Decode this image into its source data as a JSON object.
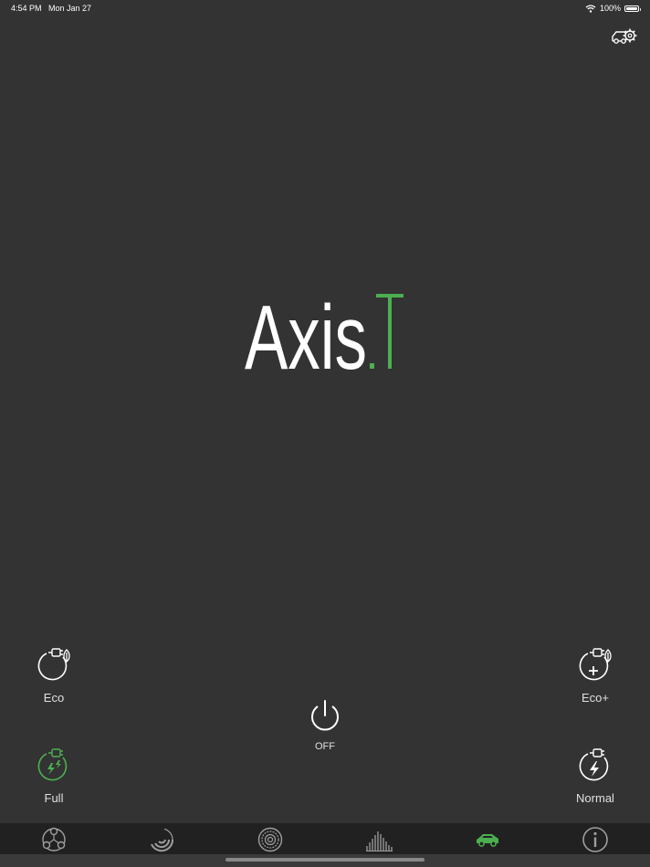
{
  "status_bar": {
    "time": "4:54 PM",
    "date": "Mon Jan 27",
    "battery": "100%"
  },
  "logo": {
    "text_main": "Axis",
    "text_dot": ".",
    "text_accent": "T"
  },
  "modes": {
    "eco": {
      "label": "Eco",
      "active": false
    },
    "eco_plus": {
      "label": "Eco+",
      "active": false
    },
    "full": {
      "label": "Full",
      "active": true
    },
    "normal": {
      "label": "Normal",
      "active": false
    }
  },
  "power": {
    "label": "OFF"
  },
  "tabs": [
    {
      "icon": "triad-circles-icon",
      "active": false
    },
    {
      "icon": "radial-gauge-icon",
      "active": false
    },
    {
      "icon": "concentric-rings-icon",
      "active": false
    },
    {
      "icon": "equalizer-bars-icon",
      "active": false
    },
    {
      "icon": "car-icon",
      "active": true
    },
    {
      "icon": "info-icon",
      "active": false
    }
  ],
  "colors": {
    "background": "#333333",
    "accent": "#4caf50",
    "tab_bar": "#212121",
    "icon_gray": "#9e9e9e"
  }
}
